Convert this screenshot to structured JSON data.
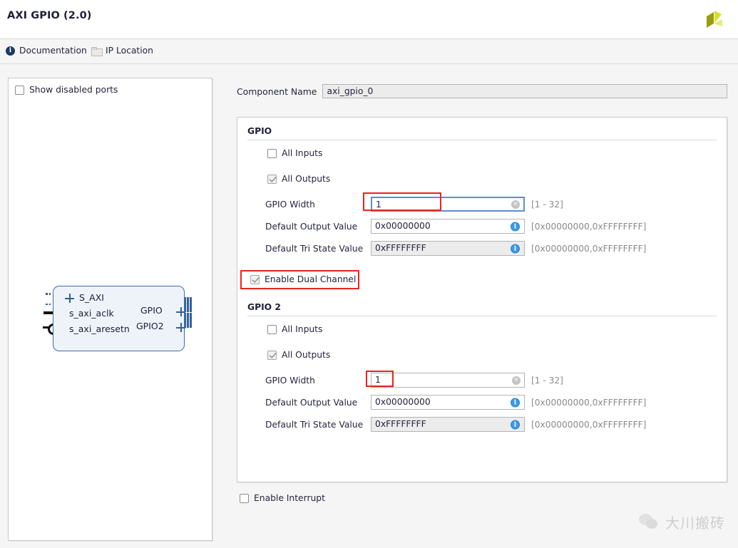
{
  "window": {
    "title": "AXI GPIO (2.0)",
    "logo_icon": "xilinx-logo-icon"
  },
  "toolbar": {
    "documentation_label": "Documentation",
    "documentation_icon": "info-circle-icon",
    "ip_location_label": "IP Location",
    "ip_location_icon": "folder-icon"
  },
  "left_panel": {
    "show_disabled_ports_label": "Show disabled ports",
    "show_disabled_ports_checked": false,
    "diagram": {
      "bus_port_label": "S_AXI",
      "clock_port_label": "s_axi_aclk",
      "reset_port_label": "s_axi_aresetn",
      "out_port_1_label": "GPIO",
      "out_port_2_label": "GPIO2"
    }
  },
  "main": {
    "component_name_label": "Component Name",
    "component_name_value": "axi_gpio_0",
    "gpio": {
      "section_title": "GPIO",
      "all_inputs_label": "All Inputs",
      "all_inputs_checked": false,
      "all_outputs_label": "All Outputs",
      "all_outputs_checked": true,
      "width_label": "GPIO Width",
      "width_value": "1",
      "width_range": "[1 - 32]",
      "default_output_label": "Default Output Value",
      "default_output_value": "0x00000000",
      "default_output_range": "[0x00000000,0xFFFFFFFF]",
      "default_tri_label": "Default Tri State Value",
      "default_tri_value": "0xFFFFFFFF",
      "default_tri_range": "[0x00000000,0xFFFFFFFF]"
    },
    "enable_dual_channel_label": "Enable Dual Channel",
    "enable_dual_channel_checked": true,
    "gpio2": {
      "section_title": "GPIO 2",
      "all_inputs_label": "All Inputs",
      "all_inputs_checked": false,
      "all_outputs_label": "All Outputs",
      "all_outputs_checked": true,
      "width_label": "GPIO Width",
      "width_value": "1",
      "width_range": "[1 - 32]",
      "default_output_label": "Default Output Value",
      "default_output_value": "0x00000000",
      "default_output_range": "[0x00000000,0xFFFFFFFF]",
      "default_tri_label": "Default Tri State Value",
      "default_tri_value": "0xFFFFFFFF",
      "default_tri_range": "[0x00000000,0xFFFFFFFF]"
    },
    "enable_interrupt_label": "Enable Interrupt",
    "enable_interrupt_checked": false
  },
  "watermark": {
    "text": "大川搬砖",
    "icon": "wechat-icon"
  },
  "icons": {
    "clear": "✕",
    "info": "i"
  },
  "colors": {
    "annotation_red": "#e8231f",
    "focus_blue": "#5b8fd0",
    "block_blue": "#34619b",
    "info_blue": "#3b9ae1",
    "panel_bg": "#f5f5f5"
  }
}
